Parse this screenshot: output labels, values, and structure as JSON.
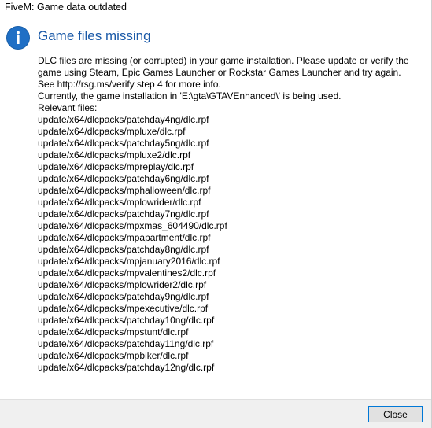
{
  "window": {
    "title": "FiveM: Game data outdated"
  },
  "icon": {
    "name": "info-icon",
    "glyph": "i",
    "color": "#1f6fc5"
  },
  "heading": "Game files missing",
  "message": {
    "paragraph1": "DLC files are missing (or corrupted) in your game installation. Please update or verify the game using Steam, Epic Games Launcher or Rockstar Games Launcher and try again. See http://rsg.ms/verify step 4 for more info.",
    "paragraph2": "Currently, the game installation in 'E:\\gta\\GTAVEnhanced\\' is being used.",
    "relevant_label": "Relevant files:",
    "files": [
      "update/x64/dlcpacks/patchday4ng/dlc.rpf",
      "update/x64/dlcpacks/mpluxe/dlc.rpf",
      "update/x64/dlcpacks/patchday5ng/dlc.rpf",
      "update/x64/dlcpacks/mpluxe2/dlc.rpf",
      "update/x64/dlcpacks/mpreplay/dlc.rpf",
      "update/x64/dlcpacks/patchday6ng/dlc.rpf",
      "update/x64/dlcpacks/mphalloween/dlc.rpf",
      "update/x64/dlcpacks/mplowrider/dlc.rpf",
      "update/x64/dlcpacks/patchday7ng/dlc.rpf",
      "update/x64/dlcpacks/mpxmas_604490/dlc.rpf",
      "update/x64/dlcpacks/mpapartment/dlc.rpf",
      "update/x64/dlcpacks/patchday8ng/dlc.rpf",
      "update/x64/dlcpacks/mpjanuary2016/dlc.rpf",
      "update/x64/dlcpacks/mpvalentines2/dlc.rpf",
      "update/x64/dlcpacks/mplowrider2/dlc.rpf",
      "update/x64/dlcpacks/patchday9ng/dlc.rpf",
      "update/x64/dlcpacks/mpexecutive/dlc.rpf",
      "update/x64/dlcpacks/patchday10ng/dlc.rpf",
      "update/x64/dlcpacks/mpstunt/dlc.rpf",
      "update/x64/dlcpacks/patchday11ng/dlc.rpf",
      "update/x64/dlcpacks/mpbiker/dlc.rpf",
      "update/x64/dlcpacks/patchday12ng/dlc.rpf"
    ]
  },
  "buttons": {
    "close_label": "Close"
  },
  "colors": {
    "heading": "#1b5aa8",
    "accent_border": "#0078d7",
    "footer_bg": "#f0f0f0"
  }
}
